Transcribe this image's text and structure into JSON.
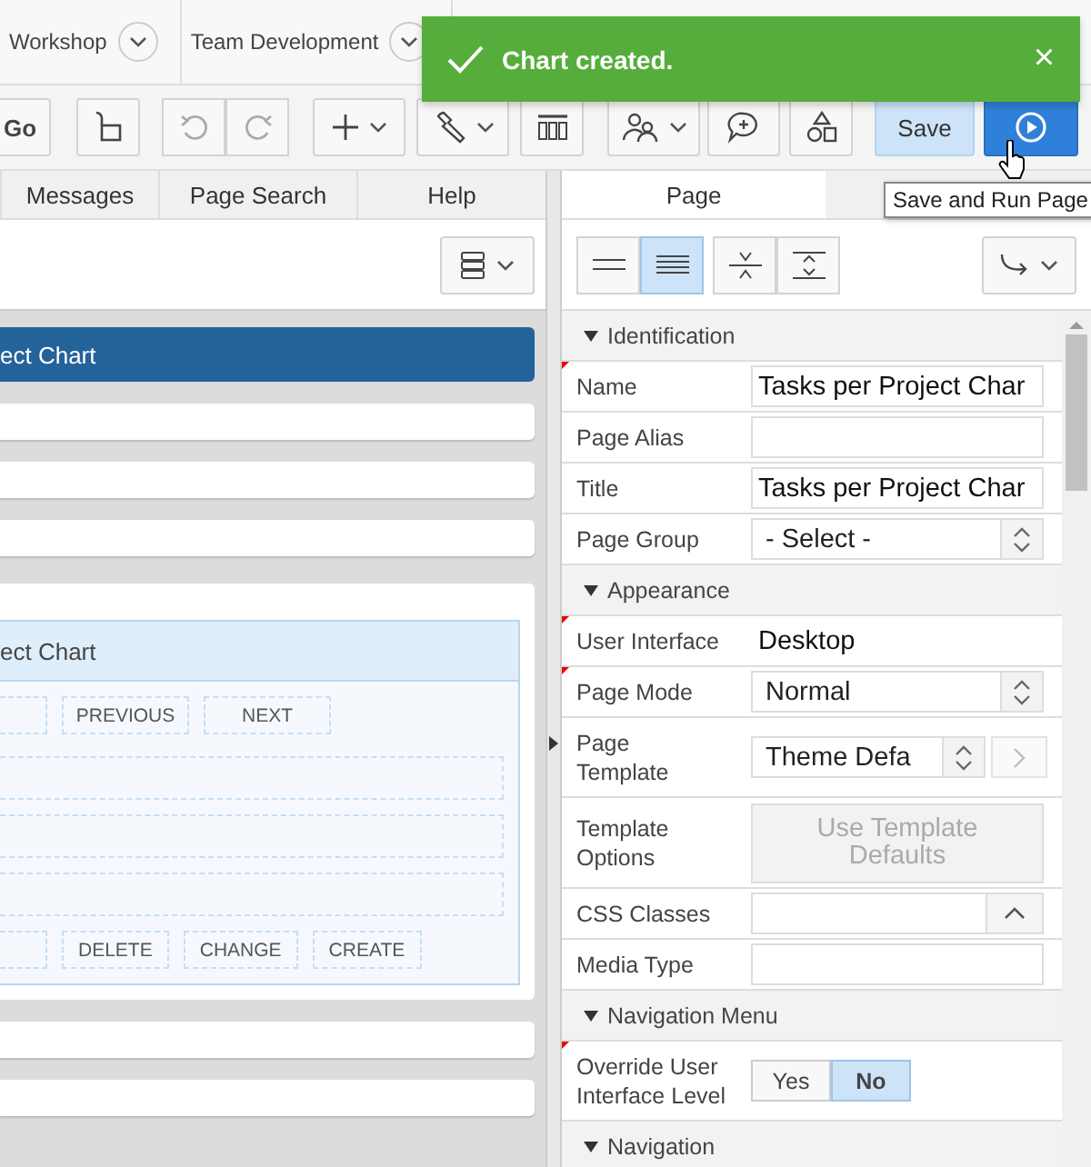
{
  "top_nav": [
    {
      "label": "Workshop"
    },
    {
      "label": "Team Development"
    }
  ],
  "toast": {
    "message": "Chart created.",
    "close": "×"
  },
  "toolbar": {
    "go": "Go",
    "save": "Save",
    "tooltip": "Save and Run Page"
  },
  "left_tabs": [
    {
      "label": "Messages",
      "selected": false
    },
    {
      "label": "Page Search",
      "selected": false
    },
    {
      "label": "Help",
      "selected": false
    }
  ],
  "layout_regions": [
    {
      "kind": "header",
      "title": "ect Chart"
    },
    {
      "kind": "bar"
    },
    {
      "kind": "bar"
    },
    {
      "kind": "bar"
    },
    {
      "kind": "card",
      "title": "ect Chart",
      "buttons_top": [
        "PREVIOUS",
        "NEXT"
      ],
      "buttons_bottom": [
        "DELETE",
        "CHANGE",
        "CREATE"
      ]
    },
    {
      "kind": "bar"
    },
    {
      "kind": "bar"
    }
  ],
  "right_tabs": [
    {
      "label": "Page",
      "selected": true
    }
  ],
  "view_modes": [
    {
      "selected": false
    },
    {
      "selected": true
    }
  ],
  "properties": [
    {
      "kind": "section",
      "label": "Identification",
      "expanded": true
    },
    {
      "kind": "text",
      "label": "Name",
      "value": "Tasks per Project Char",
      "required": true
    },
    {
      "kind": "text",
      "label": "Page Alias",
      "required": false
    },
    {
      "kind": "text",
      "label": "Title",
      "value": "Tasks per Project Char",
      "required": false
    },
    {
      "kind": "select",
      "label": "Page Group",
      "value": "- Select -",
      "required": false
    },
    {
      "kind": "section",
      "label": "Appearance",
      "expanded": true
    },
    {
      "kind": "display",
      "label": "User Interface",
      "value": "Desktop",
      "required": true
    },
    {
      "kind": "select",
      "label": "Page Mode",
      "value": "Normal",
      "required": true
    },
    {
      "kind": "select_link",
      "label": "Page Template",
      "value": "Theme Defa",
      "required": false
    },
    {
      "kind": "button",
      "label": "Template Options",
      "value": "Use Template Defaults",
      "required": false
    },
    {
      "kind": "popup",
      "label": "CSS Classes",
      "required": false
    },
    {
      "kind": "text",
      "label": "Media Type",
      "required": false
    },
    {
      "kind": "section",
      "label": "Navigation Menu",
      "expanded": true
    },
    {
      "kind": "toggle",
      "label": "Override User Interface Level",
      "required": true,
      "options": [
        {
          "label": "Yes",
          "selected": false
        },
        {
          "label": "No",
          "selected": true
        }
      ]
    },
    {
      "kind": "section",
      "label": "Navigation",
      "expanded": true
    }
  ]
}
